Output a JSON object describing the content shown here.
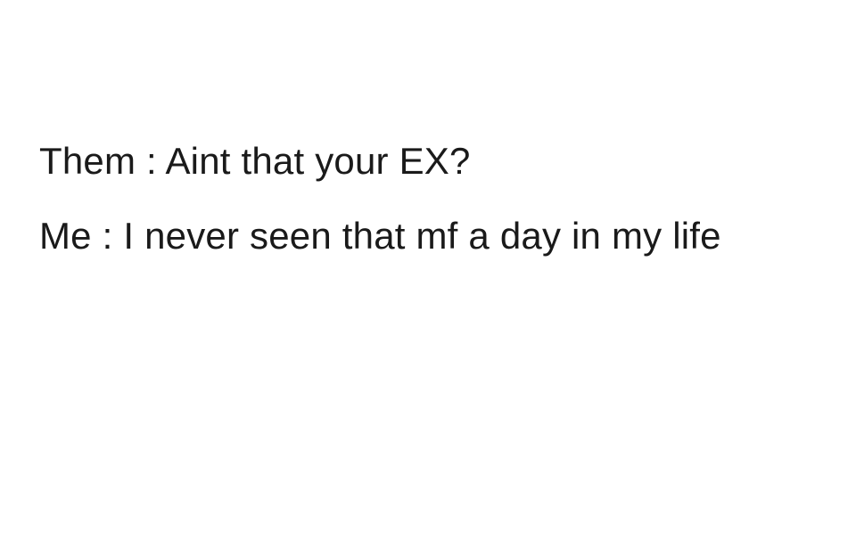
{
  "post": {
    "line1": "Them : Aint that your EX?",
    "line2": "Me : I never seen that mf a day in my life"
  },
  "colors": {
    "background": "#ffffff",
    "text": "#1a1a1a"
  }
}
